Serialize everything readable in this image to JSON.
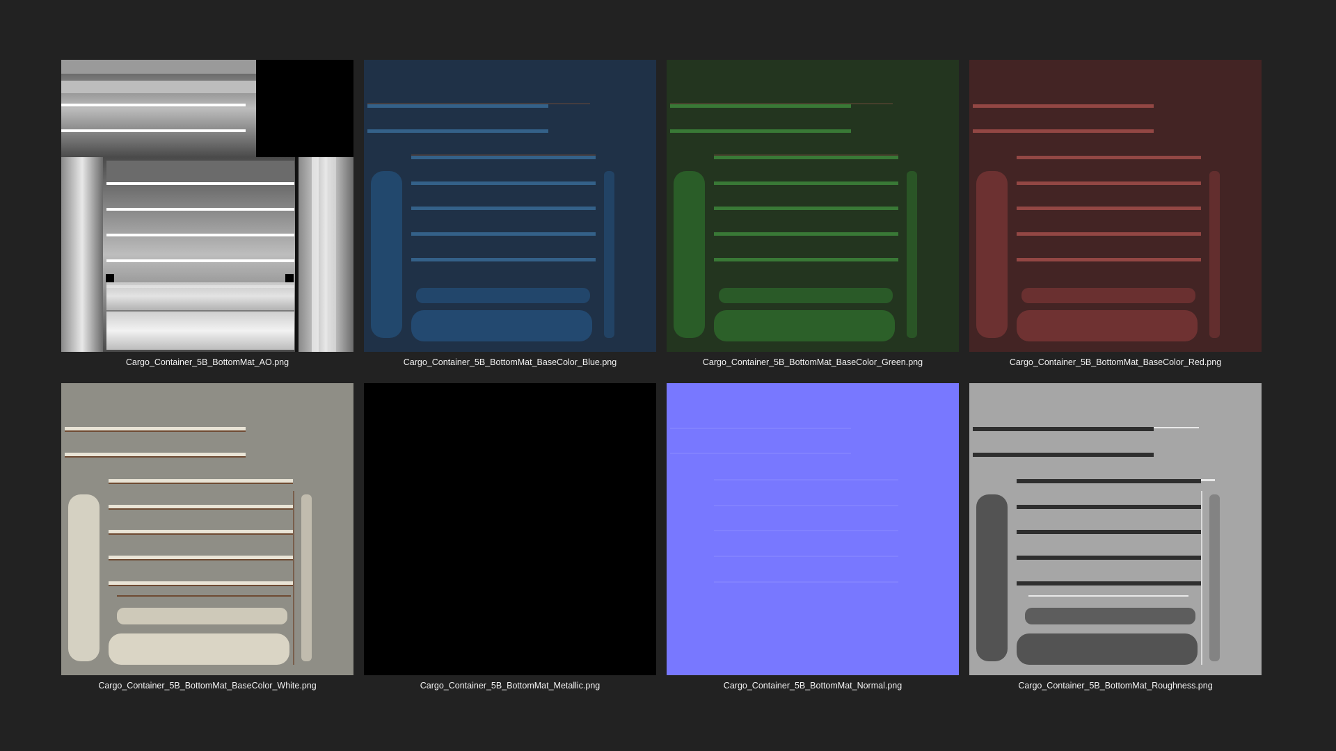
{
  "textures": [
    {
      "filename": "Cargo_Container_5B_BottomMat_AO.png",
      "map": "ambient-occlusion",
      "dominant_color": "#9a9a9a"
    },
    {
      "filename": "Cargo_Container_5B_BottomMat_BaseColor_Blue.png",
      "map": "base-color-blue",
      "dominant_color": "#1f3147"
    },
    {
      "filename": "Cargo_Container_5B_BottomMat_BaseColor_Green.png",
      "map": "base-color-green",
      "dominant_color": "#23351f"
    },
    {
      "filename": "Cargo_Container_5B_BottomMat_BaseColor_Red.png",
      "map": "base-color-red",
      "dominant_color": "#432424"
    },
    {
      "filename": "Cargo_Container_5B_BottomMat_BaseColor_White.png",
      "map": "base-color-white",
      "dominant_color": "#8f8e86"
    },
    {
      "filename": "Cargo_Container_5B_BottomMat_Metallic.png",
      "map": "metallic",
      "dominant_color": "#000000"
    },
    {
      "filename": "Cargo_Container_5B_BottomMat_Normal.png",
      "map": "normal",
      "dominant_color": "#7878ff"
    },
    {
      "filename": "Cargo_Container_5B_BottomMat_Roughness.png",
      "map": "roughness",
      "dominant_color": "#a6a6a6"
    }
  ]
}
